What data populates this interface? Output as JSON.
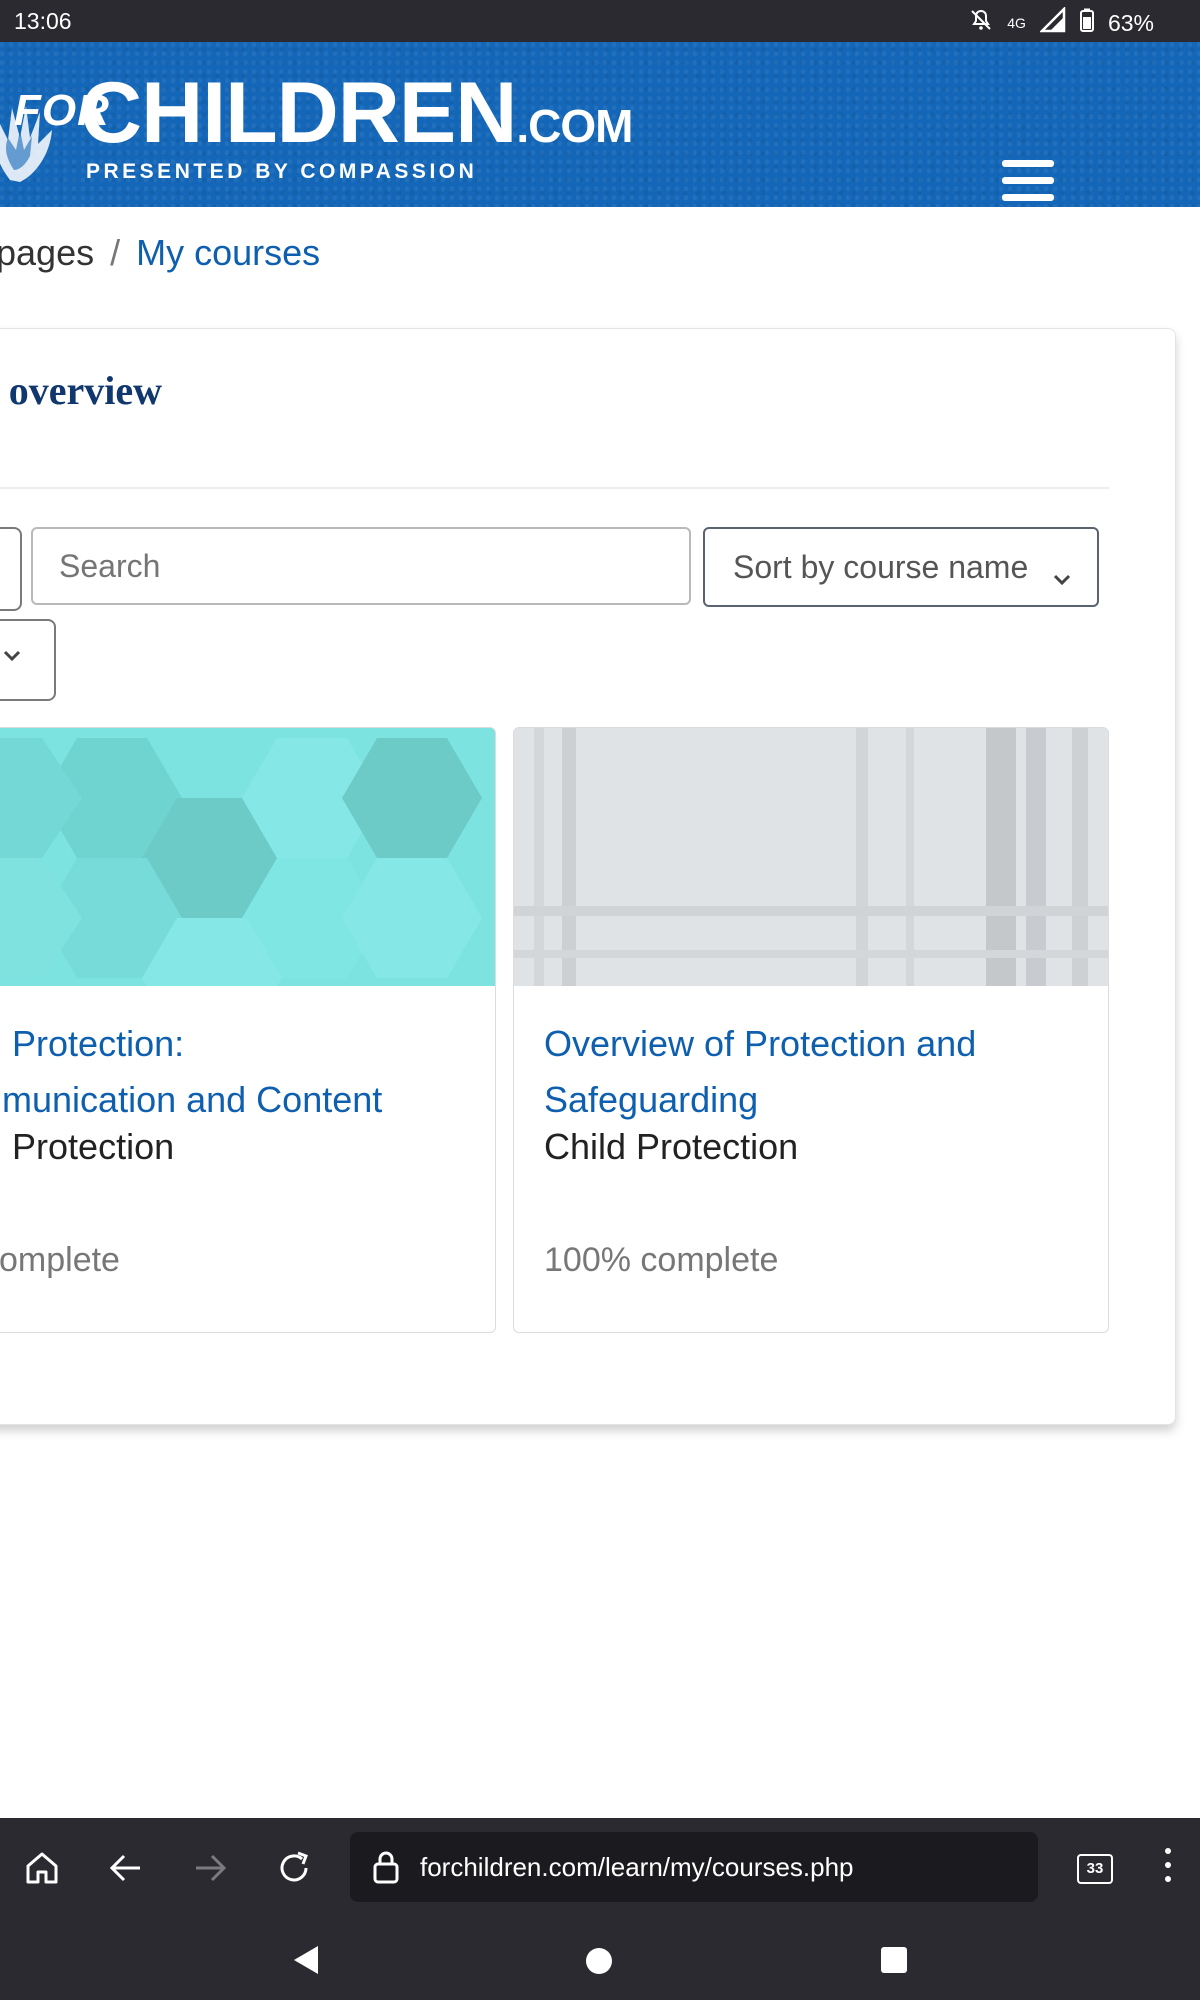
{
  "status_bar": {
    "time": "13:06",
    "battery": "63%",
    "network": "4G",
    "icons": [
      "mute-icon",
      "network-4g-icon",
      "signal-icon",
      "battery-icon"
    ]
  },
  "header": {
    "logo_for": "FOR",
    "logo_main": "CHILDREN",
    "logo_com": ".COM",
    "logo_sub": "PRESENTED BY COMPASSION",
    "menu_icon": "hamburger-icon"
  },
  "breadcrumb": {
    "parent": "pages",
    "separator": "/",
    "current": "My courses"
  },
  "course_overview": {
    "title": "e overview",
    "search": {
      "placeholder": "Search",
      "value": ""
    },
    "sort": {
      "selected": "Sort by course name"
    }
  },
  "courses": [
    {
      "name_line1": "d Protection:",
      "name_line2": "nmunication and Content",
      "category": "d Protection",
      "progress_text": "complete"
    },
    {
      "name_line1": "Overview of Protection and",
      "name_line2": "Safeguarding",
      "category": "Child Protection",
      "progress_text": "100% complete",
      "progress": 100
    }
  ],
  "browser": {
    "url": "forchildren.com/learn/my/courses.php",
    "tab_count": "33",
    "icons": [
      "home-icon",
      "back-icon",
      "forward-icon",
      "reload-icon",
      "lock-icon",
      "tabs-icon",
      "more-icon"
    ]
  },
  "colors": {
    "header_blue": "#1467b8",
    "link_blue": "#0f5faf",
    "title_navy": "#10376e",
    "tile1_bg": "#7de3e0",
    "tile2_bg": "#dfe3e6",
    "chrome_dark": "#2a2a30"
  }
}
